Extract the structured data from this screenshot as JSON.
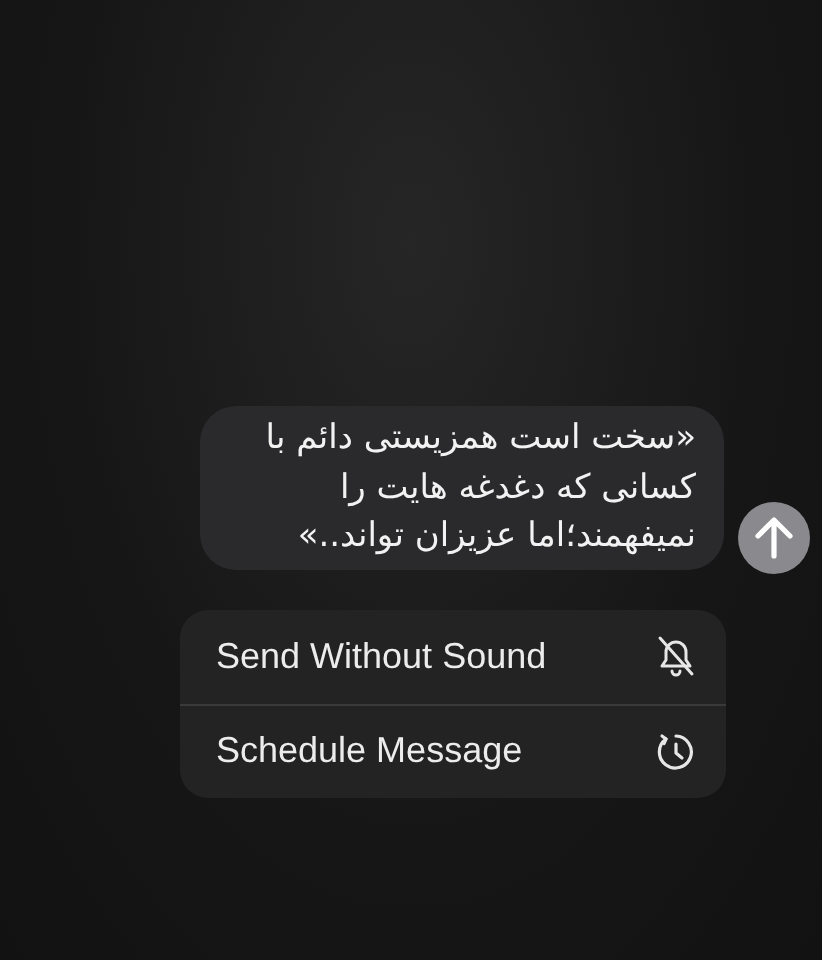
{
  "message": {
    "text": "«سخت است همزیستی دائم با\nکسانی که دغدغه هایت را\nنمیفهمند؛اما عزیزان تواند..»"
  },
  "menu": [
    {
      "label": "Send Without Sound",
      "kind": "silent"
    },
    {
      "label": "Schedule Message",
      "kind": "schedule"
    }
  ]
}
